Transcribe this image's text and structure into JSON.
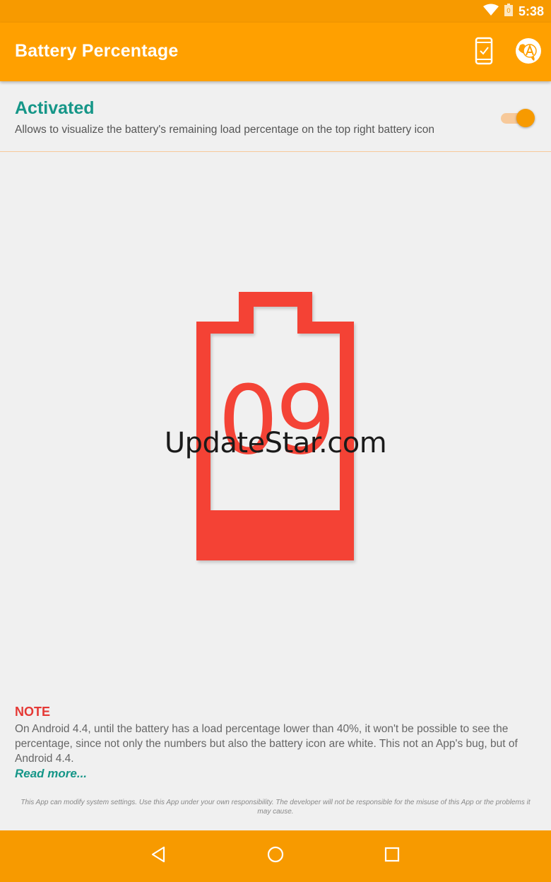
{
  "status_bar": {
    "time": "5:38",
    "icons": [
      "wifi-icon",
      "battery-icon"
    ]
  },
  "app_bar": {
    "title": "Battery Percentage",
    "actions": [
      "phone-check-icon",
      "language-globe-icon"
    ]
  },
  "settings": {
    "toggle_title": "Activated",
    "toggle_description": "Allows to visualize the battery's remaining load percentage on the top right battery icon",
    "toggle_on": true
  },
  "preview": {
    "battery_level_text": "09",
    "watermark": "UpdateStar.com"
  },
  "note": {
    "title": "NOTE",
    "text": "On Android 4.4, until the battery has a load percentage lower than 40%, it won't be possible to see the percentage, since not only the numbers but also the battery icon are white. This not an App's bug, but of Android 4.4.",
    "read_more": "Read more..."
  },
  "disclaimer": "This App can modify system settings. Use this App under your own responsibility. The developer will not be responsible for the misuse of this App or the problems it may cause.",
  "nav_bar": {
    "buttons": [
      "back-icon",
      "home-icon",
      "recents-icon"
    ]
  },
  "colors": {
    "accent": "#ffa000",
    "status_bar": "#f79a00",
    "teal": "#159688",
    "battery_red": "#f44336"
  }
}
